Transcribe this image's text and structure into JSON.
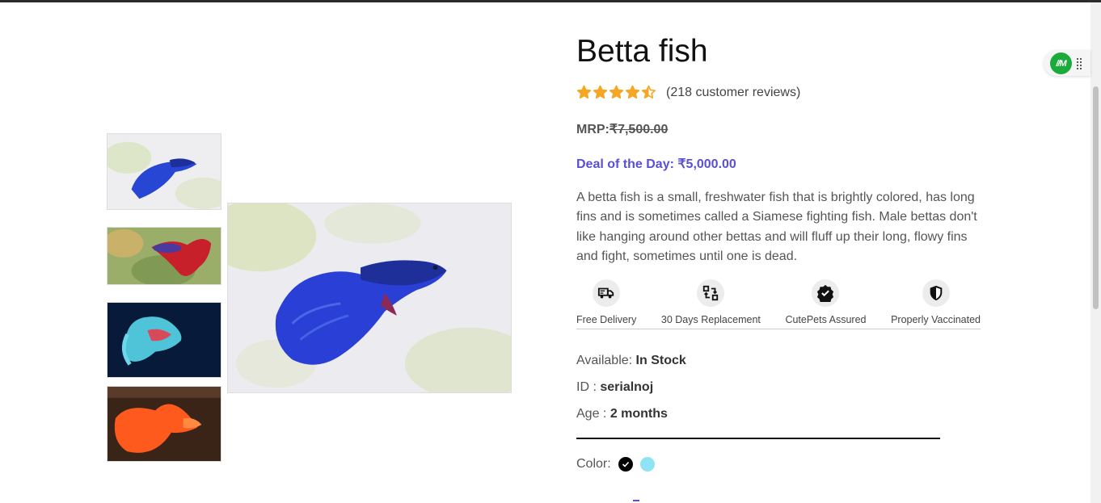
{
  "product": {
    "title": "Betta fish",
    "reviews": "(218 customer reviews)",
    "rating": 4.5,
    "rating_max": 5,
    "mrp_label": "MRP:",
    "mrp_price": "₹7,500.00",
    "deal_label": "Deal of the Day: ₹5,000.00",
    "description": "A betta fish is a small, freshwater fish that is brightly colored, has long fins and is sometimes called a Siamese fighting fish. Male bettas don't like hanging around other bettas and will fluff up their long, flowy fins and fight, sometimes until one is dead."
  },
  "features": [
    {
      "label": "Free Delivery",
      "icon": "truck-icon"
    },
    {
      "label": "30 Days Replacement",
      "icon": "replacement-icon"
    },
    {
      "label": "CutePets Assured",
      "icon": "assured-badge-icon"
    },
    {
      "label": "Properly Vaccinated",
      "icon": "shield-icon"
    }
  ],
  "info": {
    "available_label": "Available: ",
    "available_value": "In Stock",
    "id_label": "ID : ",
    "id_value": "serialnoj",
    "age_label": "Age : ",
    "age_value": "2 months"
  },
  "color": {
    "label": "Color:",
    "options": [
      "#000000",
      "#8ee4f5"
    ],
    "selected": 0
  },
  "colors": {
    "accent": "#5a4fd8",
    "star": "#f5a623",
    "extension": "#1aab3c"
  },
  "extension": {
    "logo": "//M"
  }
}
